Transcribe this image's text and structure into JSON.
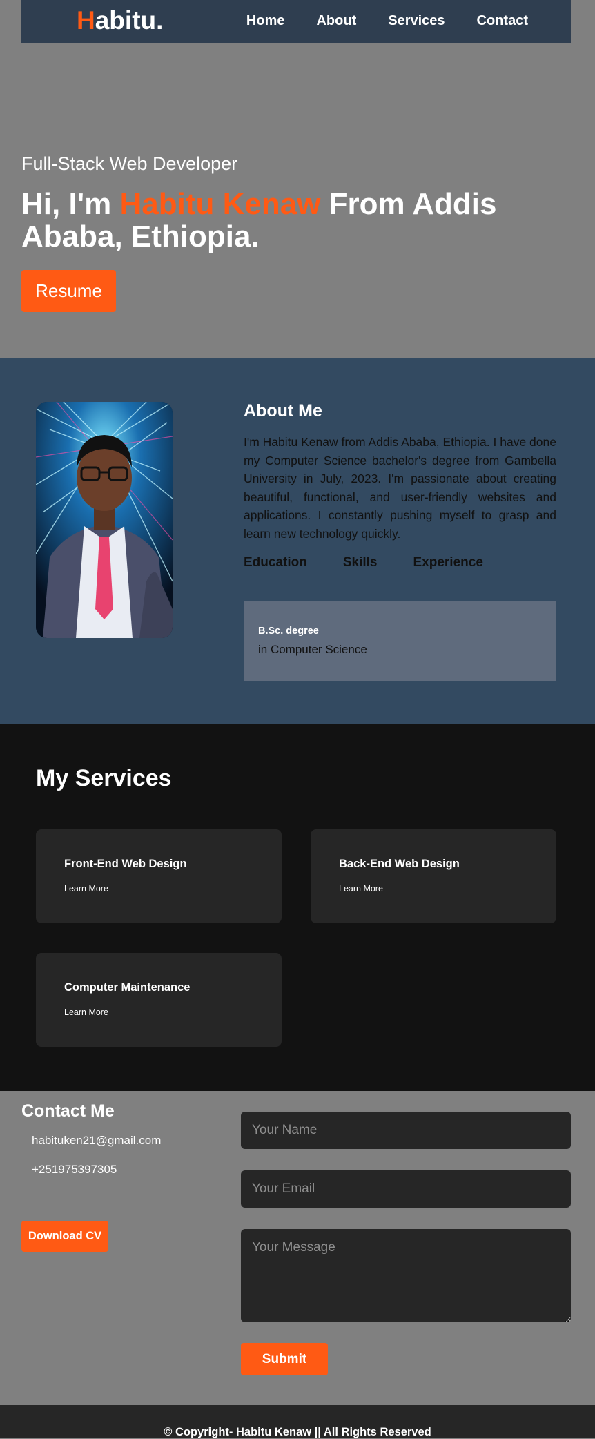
{
  "nav": {
    "logo_first": "H",
    "logo_rest": "abitu.",
    "links": [
      "Home",
      "About",
      "Services",
      "Contact"
    ]
  },
  "hero": {
    "subtitle": "Full-Stack Web Developer",
    "title_prefix": "Hi, I'm ",
    "title_name": "Habitu Kenaw",
    "title_suffix": " From Addis Ababa, Ethiopia.",
    "resume_label": "Resume"
  },
  "about": {
    "heading": "About Me",
    "paragraph": "I'm Habitu Kenaw from Addis Ababa, Ethiopia. I have done my Computer Science bachelor's degree from Gambella University in July, 2023. I'm passionate about creating beautiful, functional, and user-friendly websites and applications. I constantly pushing myself to grasp and learn new technology quickly.",
    "tabs": [
      "Education",
      "Skills",
      "Experience"
    ],
    "panel": {
      "title": "B.Sc. degree",
      "description": "in Computer Science"
    }
  },
  "services": {
    "heading": "My Services",
    "cards": [
      {
        "title": "Front-End Web Design",
        "link": "Learn More"
      },
      {
        "title": "Back-End Web Design",
        "link": "Learn More"
      },
      {
        "title": "Computer Maintenance",
        "link": "Learn More"
      }
    ]
  },
  "contact": {
    "heading": "Contact Me",
    "email": "habituken21@gmail.com",
    "phone": "+251975397305",
    "cv_label": "Download CV",
    "name_placeholder": "Your Name",
    "email_placeholder": "Your Email",
    "message_placeholder": "Your Message",
    "submit_label": "Submit"
  },
  "footer": {
    "text": "© Copyright- Habitu Kenaw || All Rights Reserved"
  },
  "colors": {
    "accent": "#ff5a14",
    "nav_bg": "#2f3e50",
    "about_bg": "#334a61",
    "services_bg": "#121212",
    "card_bg": "#262626",
    "page_bg": "#808080"
  }
}
